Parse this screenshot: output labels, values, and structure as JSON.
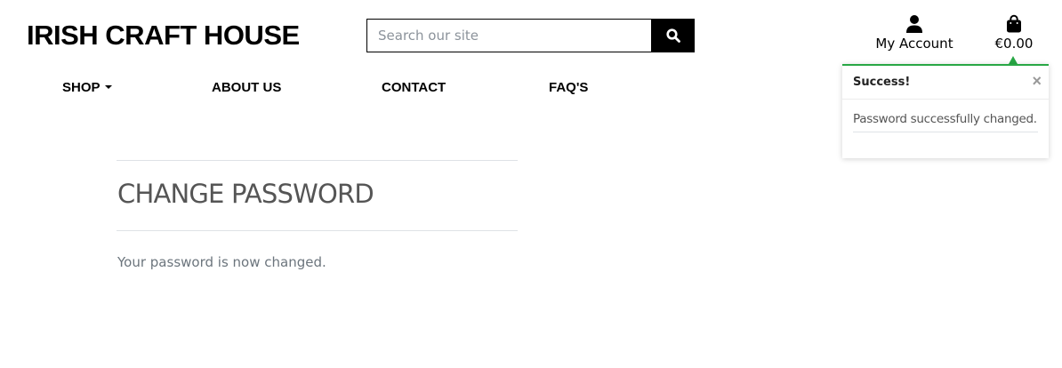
{
  "header": {
    "logo": "IRISH CRAFT HOUSE",
    "search": {
      "placeholder": "Search our site",
      "value": ""
    },
    "account_label": "My Account",
    "cart_total": "€0.00"
  },
  "nav": {
    "items": [
      {
        "label": "SHOP"
      },
      {
        "label": "ABOUT US"
      },
      {
        "label": "CONTACT"
      },
      {
        "label": "FAQ'S"
      }
    ]
  },
  "main": {
    "title": "CHANGE PASSWORD",
    "message": "Your password is now changed."
  },
  "toast": {
    "title": "Success!",
    "close": "×",
    "message": "Password successfully changed."
  },
  "colors": {
    "accent": "#28a745",
    "text_primary": "#000000",
    "text_muted": "#6c757d",
    "title_gray": "#555555"
  },
  "icons": {
    "search": "search-icon",
    "account": "user-icon",
    "cart": "shopping-bag-icon",
    "dropdown": "caret-down-icon",
    "close": "close-icon"
  }
}
